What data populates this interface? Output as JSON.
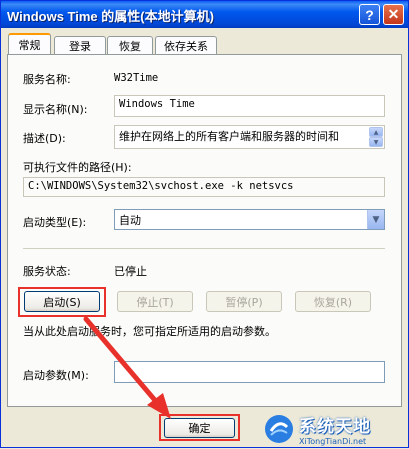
{
  "window": {
    "title": "Windows Time 的属性(本地计算机)",
    "help_label": "?",
    "close_label": "✕"
  },
  "tabs": [
    {
      "label": "常规"
    },
    {
      "label": "登录"
    },
    {
      "label": "恢复"
    },
    {
      "label": "依存关系"
    }
  ],
  "general": {
    "service_name_label": "服务名称:",
    "service_name_value": "W32Time",
    "display_name_label": "显示名称(N):",
    "display_name_value": "Windows Time",
    "description_label": "描述(D):",
    "description_value": "维护在网络上的所有客户端和服务器的时间和",
    "exe_path_label": "可执行文件的路径(H):",
    "exe_path_value": "C:\\WINDOWS\\System32\\svchost.exe -k netsvcs",
    "startup_type_label": "启动类型(E):",
    "startup_type_value": "自动",
    "service_status_label": "服务状态:",
    "service_status_value": "已停止",
    "start_button": "启动(S)",
    "stop_button": "停止(T)",
    "pause_button": "暂停(P)",
    "resume_button": "恢复(R)",
    "hint_text": "当从此处启动服务时，您可指定所适用的启动参数。",
    "start_params_label": "启动参数(M):",
    "start_params_value": ""
  },
  "footer": {
    "ok_button": "确定"
  },
  "watermark": {
    "text": "系统天地",
    "subtext": "XiTongTianDi.net"
  },
  "colors": {
    "annotation_red": "#e8312b",
    "titlebar_blue": "#0058ee"
  }
}
